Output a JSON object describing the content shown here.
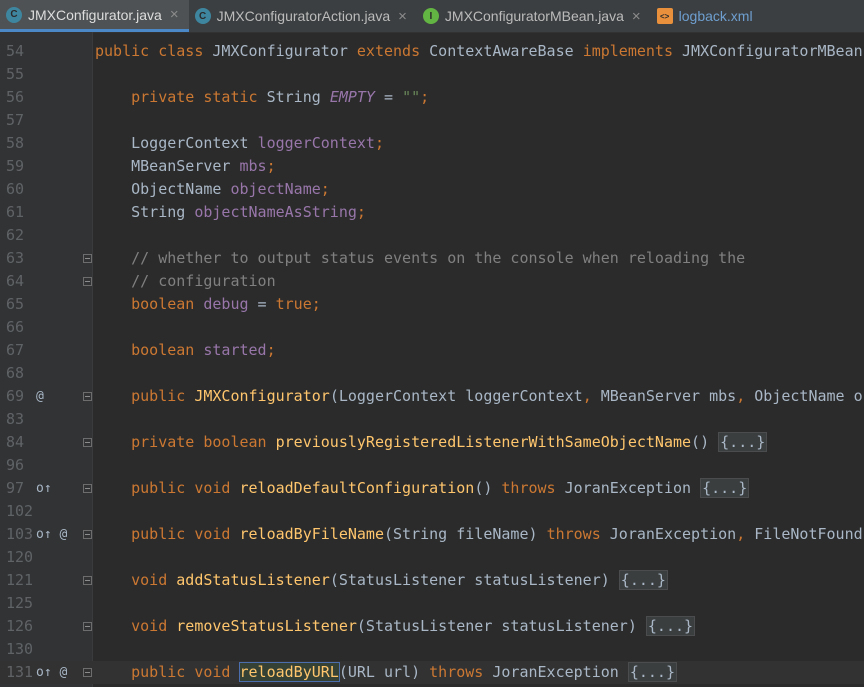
{
  "tabs": [
    {
      "label": "JMXConfigurator.java",
      "icon": "class-icon",
      "active": true
    },
    {
      "label": "JMXConfiguratorAction.java",
      "icon": "class-icon"
    },
    {
      "label": "JMXConfiguratorMBean.java",
      "icon": "interface-icon"
    },
    {
      "label": "logback.xml",
      "icon": "xml-file-icon"
    }
  ],
  "close_glyph": "×",
  "lines": [
    {
      "n": "54",
      "segs": [
        [
          "kw",
          "public class "
        ],
        [
          "",
          "JMXConfigurator "
        ],
        [
          "kw",
          "extends "
        ],
        [
          "",
          "ContextAwareBase "
        ],
        [
          "kw",
          "implements "
        ],
        [
          "",
          "JMXConfiguratorMBean"
        ],
        [
          "kw",
          ","
        ]
      ]
    },
    {
      "n": "55",
      "segs": []
    },
    {
      "n": "56",
      "segs": [
        [
          "",
          "    "
        ],
        [
          "kw",
          "private static "
        ],
        [
          "",
          "String "
        ],
        [
          "cfld",
          "EMPTY"
        ],
        [
          "",
          " = "
        ],
        [
          "str",
          "\"\""
        ],
        [
          "kw",
          ";"
        ]
      ]
    },
    {
      "n": "57",
      "segs": []
    },
    {
      "n": "58",
      "segs": [
        [
          "",
          "    LoggerContext "
        ],
        [
          "fld",
          "loggerContext"
        ],
        [
          "kw",
          ";"
        ]
      ]
    },
    {
      "n": "59",
      "segs": [
        [
          "",
          "    MBeanServer "
        ],
        [
          "fld",
          "mbs"
        ],
        [
          "kw",
          ";"
        ]
      ]
    },
    {
      "n": "60",
      "segs": [
        [
          "",
          "    ObjectName "
        ],
        [
          "fld",
          "objectName"
        ],
        [
          "kw",
          ";"
        ]
      ]
    },
    {
      "n": "61",
      "segs": [
        [
          "",
          "    String "
        ],
        [
          "fld",
          "objectNameAsString"
        ],
        [
          "kw",
          ";"
        ]
      ]
    },
    {
      "n": "62",
      "segs": []
    },
    {
      "n": "63",
      "fold": true,
      "segs": [
        [
          "",
          "    "
        ],
        [
          "cmt",
          "// whether to output status events on the console when reloading the"
        ]
      ]
    },
    {
      "n": "64",
      "fold": true,
      "segs": [
        [
          "",
          "    "
        ],
        [
          "cmt",
          "// configuration"
        ]
      ]
    },
    {
      "n": "65",
      "segs": [
        [
          "",
          "    "
        ],
        [
          "kw",
          "boolean "
        ],
        [
          "fld",
          "debug"
        ],
        [
          "",
          " = "
        ],
        [
          "kw",
          "true;"
        ]
      ]
    },
    {
      "n": "66",
      "segs": []
    },
    {
      "n": "67",
      "segs": [
        [
          "",
          "    "
        ],
        [
          "kw",
          "boolean "
        ],
        [
          "fld",
          "started"
        ],
        [
          "kw",
          ";"
        ]
      ]
    },
    {
      "n": "68",
      "segs": []
    },
    {
      "n": "69",
      "marks": "@",
      "fold": true,
      "segs": [
        [
          "",
          "    "
        ],
        [
          "kw",
          "public "
        ],
        [
          "fn",
          "JMXConfigurator"
        ],
        [
          "",
          "(LoggerContext loggerContext"
        ],
        [
          "kw",
          ", "
        ],
        [
          "",
          "MBeanServer mbs"
        ],
        [
          "kw",
          ", "
        ],
        [
          "",
          "ObjectName ob"
        ]
      ]
    },
    {
      "n": "83",
      "segs": []
    },
    {
      "n": "84",
      "fold": true,
      "segs": [
        [
          "",
          "    "
        ],
        [
          "kw",
          "private boolean "
        ],
        [
          "fn",
          "previouslyRegisteredListenerWithSameObjectName"
        ],
        [
          "",
          "() "
        ],
        [
          "fold-text",
          "{...}"
        ]
      ]
    },
    {
      "n": "96",
      "segs": []
    },
    {
      "n": "97",
      "marks": "o↑",
      "fold": true,
      "segs": [
        [
          "",
          "    "
        ],
        [
          "kw",
          "public void "
        ],
        [
          "fn",
          "reloadDefaultConfiguration"
        ],
        [
          "",
          "() "
        ],
        [
          "kw",
          "throws "
        ],
        [
          "",
          "JoranException "
        ],
        [
          "fold-text",
          "{...}"
        ]
      ]
    },
    {
      "n": "102",
      "segs": []
    },
    {
      "n": "103",
      "marks": "o↑ @",
      "fold": true,
      "segs": [
        [
          "",
          "    "
        ],
        [
          "kw",
          "public void "
        ],
        [
          "fn",
          "reloadByFileName"
        ],
        [
          "",
          "(String fileName) "
        ],
        [
          "kw",
          "throws "
        ],
        [
          "",
          "JoranException"
        ],
        [
          "kw",
          ", "
        ],
        [
          "",
          "FileNotFoundE"
        ]
      ]
    },
    {
      "n": "120",
      "segs": []
    },
    {
      "n": "121",
      "fold": true,
      "segs": [
        [
          "",
          "    "
        ],
        [
          "kw",
          "void "
        ],
        [
          "fn",
          "addStatusListener"
        ],
        [
          "",
          "(StatusListener statusListener) "
        ],
        [
          "fold-text",
          "{...}"
        ]
      ]
    },
    {
      "n": "125",
      "segs": []
    },
    {
      "n": "126",
      "fold": true,
      "segs": [
        [
          "",
          "    "
        ],
        [
          "kw",
          "void "
        ],
        [
          "fn",
          "removeStatusListener"
        ],
        [
          "",
          "(StatusListener statusListener) "
        ],
        [
          "fold-text",
          "{...}"
        ]
      ]
    },
    {
      "n": "130",
      "segs": []
    },
    {
      "n": "131",
      "marks": "o↑ @",
      "fold": true,
      "caret": true,
      "segs": [
        [
          "",
          "    "
        ],
        [
          "kw",
          "public void "
        ],
        [
          "hl fn",
          "reloadByURL"
        ],
        [
          "",
          "(URL url) "
        ],
        [
          "kw",
          "throws "
        ],
        [
          "",
          "JoranException "
        ],
        [
          "fold-text",
          "{...}"
        ]
      ]
    }
  ]
}
